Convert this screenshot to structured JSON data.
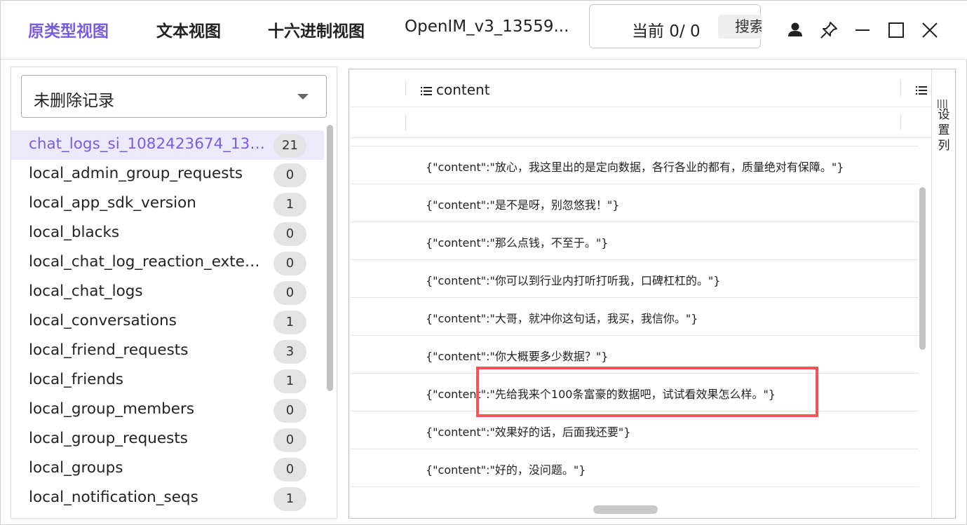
{
  "tabs": [
    {
      "label": "原类型视图",
      "active": true
    },
    {
      "label": "文本视图",
      "active": false
    },
    {
      "label": "十六进制视图",
      "active": false
    },
    {
      "label": "OpenIM_v3_13559...",
      "active": false
    }
  ],
  "search": {
    "current_label": "当前 0/ 0",
    "button_label": "搜索"
  },
  "window_icons": [
    "user-icon",
    "pin-icon",
    "minimize-icon",
    "maximize-icon",
    "close-icon"
  ],
  "sidebar": {
    "filter_value": "未删除记录",
    "tables": [
      {
        "name": "chat_logs_si_1082423674_1355...",
        "count": "21",
        "selected": true
      },
      {
        "name": "local_admin_group_requests",
        "count": "0"
      },
      {
        "name": "local_app_sdk_version",
        "count": "1"
      },
      {
        "name": "local_blacks",
        "count": "0"
      },
      {
        "name": "local_chat_log_reaction_extensi...",
        "count": "0"
      },
      {
        "name": "local_chat_logs",
        "count": "0"
      },
      {
        "name": "local_conversations",
        "count": "1"
      },
      {
        "name": "local_friend_requests",
        "count": "3"
      },
      {
        "name": "local_friends",
        "count": "1"
      },
      {
        "name": "local_group_members",
        "count": "0"
      },
      {
        "name": "local_group_requests",
        "count": "0"
      },
      {
        "name": "local_groups",
        "count": "0"
      },
      {
        "name": "local_notification_seqs",
        "count": "1"
      }
    ]
  },
  "grid": {
    "column_title": "content",
    "settings_label": "设置列",
    "rows": [
      "{\"content\":\"放心，我这里出的是定向数据，各行各业的都有，质量绝对有保障。\"}",
      "{\"content\":\"是不是呀，别忽悠我！\"}",
      "{\"content\":\"那么点钱，不至于。\"}",
      "{\"content\":\"你可以到行业内打听打听我，口碑杠杠的。\"}",
      "{\"content\":\"大哥，就冲你这句话，我买，我信你。\"}",
      "{\"content\":\"你大概要多少数据？\"}",
      "{\"content\":\"先给我来个100条富豪的数据吧，试试看效果怎么样。\"}",
      "{\"content\":\"效果好的话，后面我还要\"}",
      "{\"content\":\"好的，没问题。\"}"
    ]
  },
  "colors": {
    "accent": "#7b5cdc",
    "selected_row_bg": "#ece9fb",
    "highlight_border": "#f25555"
  }
}
